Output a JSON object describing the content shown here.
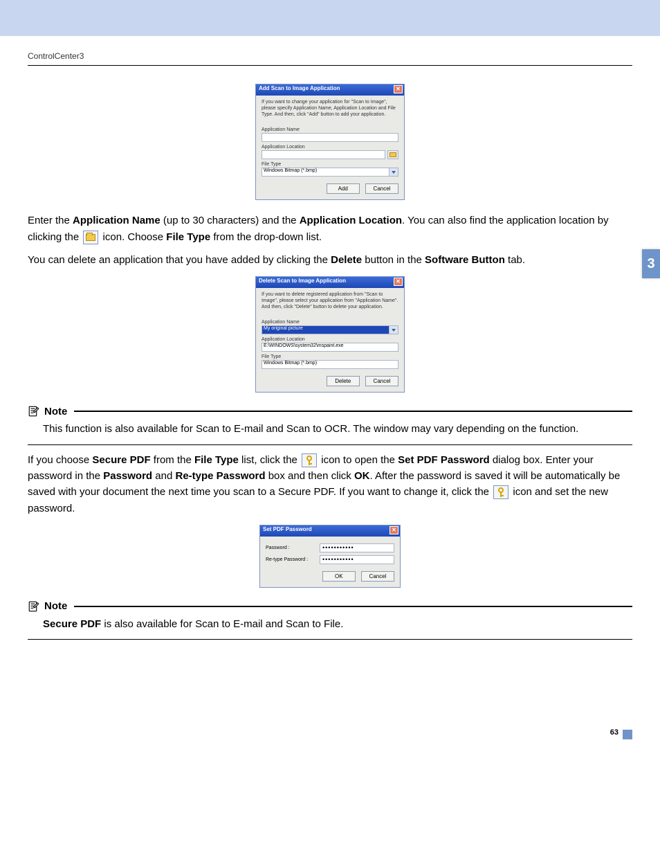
{
  "header": {
    "breadcrumb": "ControlCenter3"
  },
  "side_tab": "3",
  "page_number": "63",
  "dialog_add": {
    "title": "Add Scan to Image Application",
    "desc": "If you want to change your application for \"Scan to Image\", please specify Application Name, Application Location and File Type.\nAnd then, click \"Add\" button to add your application.",
    "labels": {
      "app_name": "Application Name",
      "app_loc": "Application Location",
      "file_type": "File Type"
    },
    "values": {
      "app_name": "",
      "app_loc": "",
      "file_type": "Windows Bitmap (*.bmp)"
    },
    "buttons": {
      "ok": "Add",
      "cancel": "Cancel"
    }
  },
  "para1_pre": "Enter the ",
  "para1_b1": "Application Name",
  "para1_mid1": " (up to 30 characters) and the ",
  "para1_b2": "Application Location",
  "para1_mid2": ". You can also find the application location by clicking the ",
  "para1_mid3": " icon. Choose ",
  "para1_b3": "File Type",
  "para1_post": " from the drop-down list.",
  "para2_pre": "You can delete an application that you have added by clicking the ",
  "para2_b1": "Delete",
  "para2_mid": " button in the ",
  "para2_b2": "Software Button",
  "para2_post": " tab.",
  "dialog_del": {
    "title": "Delete Scan to Image Application",
    "desc": "If you want to delete registered application from \"Scan to Image\", please select your application from \"Application Name\".\nAnd then, click \"Delete\" button to delete your application.",
    "labels": {
      "app_name": "Application Name",
      "app_loc": "Application Location",
      "file_type": "File Type"
    },
    "values": {
      "app_name": "My original picture",
      "app_loc": "E:\\WINDOWS\\system32\\mspaint.exe",
      "file_type": "Windows Bitmap (*.bmp)"
    },
    "buttons": {
      "ok": "Delete",
      "cancel": "Cancel"
    }
  },
  "note1": {
    "title": "Note",
    "body": "This function is also available for Scan to E-mail and Scan to OCR. The window may vary depending on the function."
  },
  "para3_pre": "If you choose ",
  "para3_b1": "Secure PDF",
  "para3_mid1": " from the ",
  "para3_b2": "File Type",
  "para3_mid2": " list, click the ",
  "para3_mid3": " icon to open the ",
  "para3_b3": "Set PDF Password",
  "para3_mid4": " dialog box. Enter your password in the ",
  "para3_b4": "Password",
  "para3_mid5": " and ",
  "para3_b5": "Re-type Password",
  "para3_mid6": " box and then click ",
  "para3_b6": "OK",
  "para3_mid7": ". After the password is saved it will be automatically be saved with your document the next time you scan to a Secure PDF. If you want to change it, click the ",
  "para3_post": " icon and set the new password.",
  "dialog_pw": {
    "title": "Set PDF Password",
    "labels": {
      "pw": "Password :",
      "pw2": "Re-type Password :"
    },
    "values": {
      "mask": "•••••••••••"
    },
    "buttons": {
      "ok": "OK",
      "cancel": "Cancel"
    }
  },
  "note2": {
    "title": "Note",
    "body_b": "Secure PDF",
    "body_rest": " is also available for Scan to E-mail and Scan to File."
  }
}
